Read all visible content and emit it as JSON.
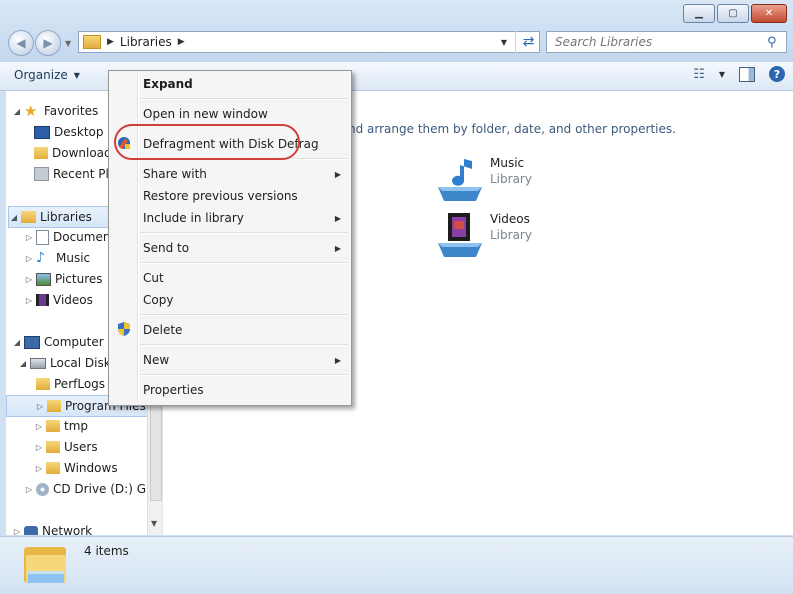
{
  "window": {
    "buttons": [
      "minimize",
      "maximize",
      "close"
    ]
  },
  "address": {
    "crumbs": [
      "Libraries"
    ]
  },
  "search": {
    "placeholder": "Search Libraries"
  },
  "toolbar": {
    "organize_label": "Organize"
  },
  "nav_pane": {
    "favorites": {
      "label": "Favorites",
      "items": [
        "Desktop",
        "Downloads",
        "Recent Places"
      ]
    },
    "libraries": {
      "label": "Libraries",
      "items": [
        "Documents",
        "Music",
        "Pictures",
        "Videos"
      ]
    },
    "computer": {
      "label": "Computer",
      "local_disk": "Local Disk (C:)",
      "folders": [
        "PerfLogs",
        "Program Files",
        "tmp",
        "Users",
        "Windows"
      ],
      "cd_drive": "CD Drive (D:) GRMC"
    },
    "network": "Network"
  },
  "content": {
    "hint": "nd arrange them by folder, date, and other properties.",
    "libraries": [
      {
        "name": "Music",
        "type": "Library"
      },
      {
        "name": "Videos",
        "type": "Library"
      }
    ]
  },
  "status": {
    "count": "4 items"
  },
  "context_menu": {
    "expand": "Expand",
    "open_new_window": "Open in new window",
    "defrag": "Defragment with Disk Defrag",
    "share_with": "Share with",
    "restore": "Restore previous versions",
    "include": "Include in library",
    "send_to": "Send to",
    "cut": "Cut",
    "copy": "Copy",
    "delete": "Delete",
    "new": "New",
    "properties": "Properties"
  },
  "colors": {
    "highlight_ring": "#d0403a",
    "selection": "#d6e6f8"
  }
}
